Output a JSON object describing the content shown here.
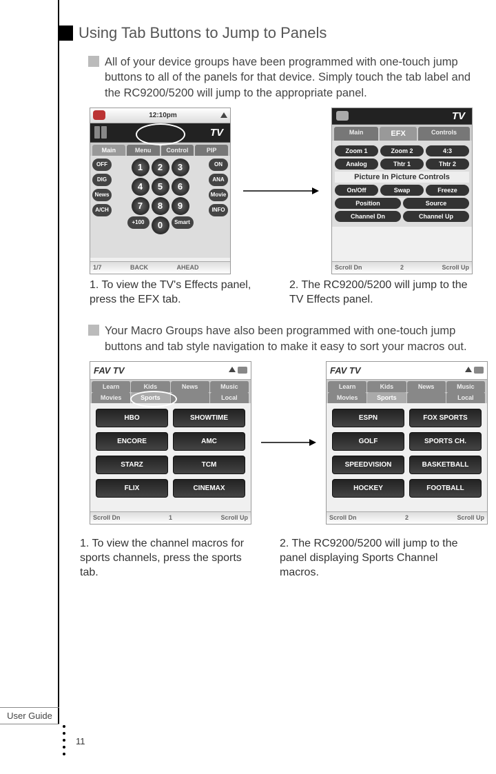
{
  "heading": "Using Tab Buttons to Jump to Panels",
  "para1": "All of your device groups have been programmed with  one-touch  jump buttons to all of the panels for that device. Simply touch the tab label and the RC9200/5200 will jump to the appropriate panel.",
  "para2": "Your Macro Groups have also been programmed with  one-touch  jump buttons and tab style navigation to make it easy to sort your macros out.",
  "caption1a": "1. To view the TV's  Effects  panel, press the EFX tab.",
  "caption1b": "2. The RC9200/5200 will jump to the TV Effects panel.",
  "caption2a": "1. To view the channel macros for sports channels, press the sports tab.",
  "caption2b": "2. The RC9200/5200 will jump to the panel displaying Sports Channel macros.",
  "user_guide": "User Guide",
  "page_number": "11",
  "screen1": {
    "time": "12:10pm",
    "device": "TV",
    "tabs": [
      "Main",
      "Menu",
      "Control",
      "PIP"
    ],
    "side_left": [
      "OFF",
      "DIG",
      "News",
      "A/CH"
    ],
    "side_right": [
      "ON",
      "ANA",
      "Movie",
      "INFO"
    ],
    "extra": [
      "+100",
      "Smart"
    ],
    "nums": [
      "1",
      "2",
      "3",
      "4",
      "5",
      "6",
      "7",
      "8",
      "9",
      "0"
    ],
    "footer": {
      "left": "1/7",
      "mid1": "BACK",
      "mid2": "AHEAD"
    }
  },
  "screen2": {
    "device": "TV",
    "tabs": [
      "Main",
      "EFX",
      "Controls"
    ],
    "row1": [
      "Zoom 1",
      "Zoom 2",
      "4:3"
    ],
    "row2": [
      "Analog",
      "Thtr 1",
      "Thtr 2"
    ],
    "section": "Picture In Picture Controls",
    "row3": [
      "On/Off",
      "Swap",
      "Freeze"
    ],
    "row4": [
      "Position",
      "Source"
    ],
    "row5": [
      "Channel Dn",
      "Channel Up"
    ],
    "footer": {
      "left": "Scroll Dn",
      "mid": "2",
      "right": "Scroll Up"
    }
  },
  "screen3": {
    "title": "FAV TV",
    "tabs": [
      "Learn",
      "Kids",
      "News",
      "Music",
      "Movies",
      "Sports",
      "",
      "Local"
    ],
    "active_tab_index": 5,
    "channels": [
      "HBO",
      "SHOWTIME",
      "ENCORE",
      "AMC",
      "STARZ",
      "TCM",
      "FLIX",
      "CINEMAX"
    ],
    "footer": {
      "left": "Scroll Dn",
      "mid": "1",
      "right": "Scroll Up"
    }
  },
  "screen4": {
    "title": "FAV TV",
    "tabs": [
      "Learn",
      "Kids",
      "News",
      "Music",
      "Movies",
      "Sports",
      "",
      "Local"
    ],
    "active_tab_index": 5,
    "channels": [
      "ESPN",
      "FOX SPORTS",
      "GOLF",
      "SPORTS CH.",
      "SPEEDVISION",
      "BASKETBALL",
      "HOCKEY",
      "FOOTBALL"
    ],
    "footer": {
      "left": "Scroll Dn",
      "mid": "2",
      "right": "Scroll Up"
    }
  }
}
